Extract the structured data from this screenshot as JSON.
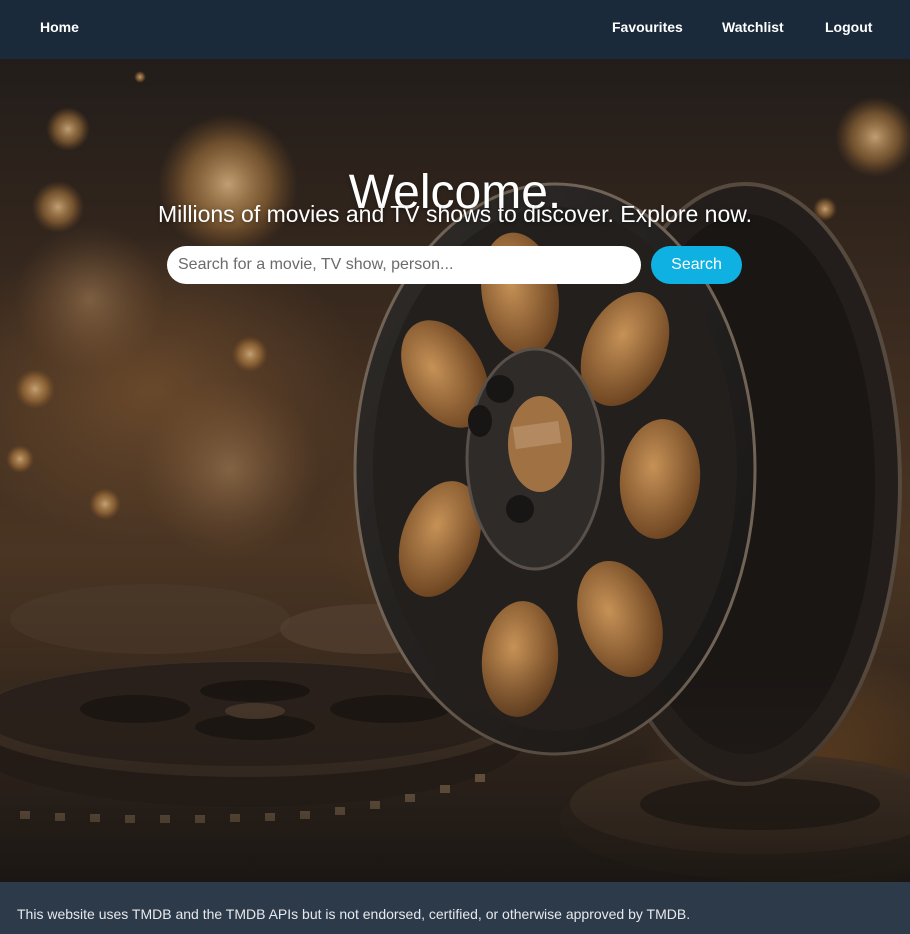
{
  "nav": {
    "home": "Home",
    "favourites": "Favourites",
    "watchlist": "Watchlist",
    "logout": "Logout"
  },
  "hero": {
    "title": "Welcome.",
    "subtitle": "Millions of movies and TV shows to discover. Explore now.",
    "background_image": "film-reels-bokeh"
  },
  "search": {
    "placeholder": "Search for a movie, TV show, person...",
    "value": "",
    "button_label": "Search"
  },
  "footer": {
    "text": "This website uses TMDB and the TMDB APIs but is not endorsed, certified, or otherwise approved by TMDB."
  },
  "colors": {
    "navbar": "#1b2a3b",
    "footer": "#2d3a4a",
    "search_button": "#0fb1e3",
    "text": "#ffffff"
  }
}
